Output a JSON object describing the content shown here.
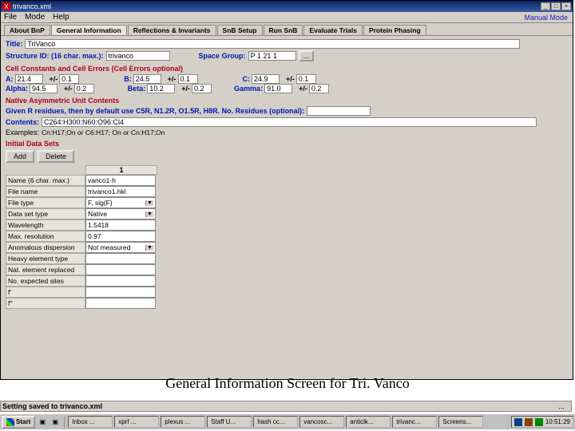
{
  "titlebar": {
    "filename": "trivanco.xml"
  },
  "menu": {
    "file": "File",
    "mode": "Mode",
    "help": "Help",
    "mode_right": "Manual Mode"
  },
  "tabs": {
    "about": "About BnP",
    "general": "General Information",
    "refl": "Reflections & Invariants",
    "setup": "SnB Setup",
    "run": "Run SnB",
    "eval": "Evaluate Trials",
    "phasing": "Protein Phasing"
  },
  "fields": {
    "title_label": "Title:",
    "title_value": "TriVanco",
    "struct_label": "Structure ID: (16 char. max.):",
    "struct_value": "trivanco",
    "space_label": "Space Group:",
    "space_value": "P 1 21 1",
    "space_btn": "..."
  },
  "section_cell": {
    "title": "Cell Constants and Cell Errors (Cell Errors optional)",
    "a": "A:",
    "a_val": "21.4",
    "a_pm": "+/-",
    "a_err": "0.1",
    "b": "B:",
    "b_val": "24.5",
    "b_pm": "+/-",
    "b_err": "0.1",
    "c": "C:",
    "c_val": "24.9",
    "c_pm": "+/-",
    "c_err": "0.1",
    "alpha": "Alpha:",
    "alpha_val": "94.5",
    "alpha_err": "0.2",
    "beta": "Beta:",
    "beta_val": "10.2",
    "beta_err": "0.2",
    "gamma": "Gamma:",
    "gamma_val": "91.0",
    "gamma_err": "0.2"
  },
  "section_native": {
    "title": "Native Asymmetric Unit Contents",
    "given": "Given R residues, then by default use C5R, N1.2R, O1.5R, H8R. No. Residues (optional):",
    "contents_label": "Contents:",
    "contents_value": "C264:H300:N60:O96:Cl4",
    "examples_label": "Examples:",
    "examples_value": "Cn:H17;On or C6:H17; On or Cn:H17;On"
  },
  "section_data": {
    "title": "Initial Data Sets",
    "add": "Add",
    "delete": "Delete",
    "col1": "1",
    "rows": {
      "name": {
        "label": "Name (6 char. max.)",
        "value": "vanco1-h"
      },
      "filename": {
        "label": "File name",
        "value": "trivanco1.hkl"
      },
      "filetype": {
        "label": "File type",
        "value": "F, sig(F)"
      },
      "dataset": {
        "label": "Data set type",
        "value": "Native"
      },
      "wavelength": {
        "label": "Wavelength",
        "value": "1.5418"
      },
      "maxres": {
        "label": "Max. resolution",
        "value": "0.97"
      },
      "anom": {
        "label": "Anomalous dispersion",
        "value": "Not measured"
      },
      "heavy": {
        "label": "Heavy element type",
        "value": ""
      },
      "natrep": {
        "label": "Nat. element replaced",
        "value": ""
      },
      "expected": {
        "label": "No. expected sites",
        "value": ""
      },
      "fp": {
        "label": "f'",
        "value": ""
      },
      "fpp": {
        "label": "f''",
        "value": ""
      }
    }
  },
  "caption": "General Information Screen for Tri. Vanco",
  "status": {
    "msg": "Setting saved to trivanco.xml",
    "dots": "..."
  },
  "taskbar": {
    "start": "Start",
    "items": [
      "Inbox ...",
      "xprf ...",
      "plexus ...",
      "Staff U...",
      "hash cc...",
      "vancosc...",
      "anticlk...",
      "trivanc...",
      "Screens..."
    ],
    "time": "10:51:29"
  }
}
